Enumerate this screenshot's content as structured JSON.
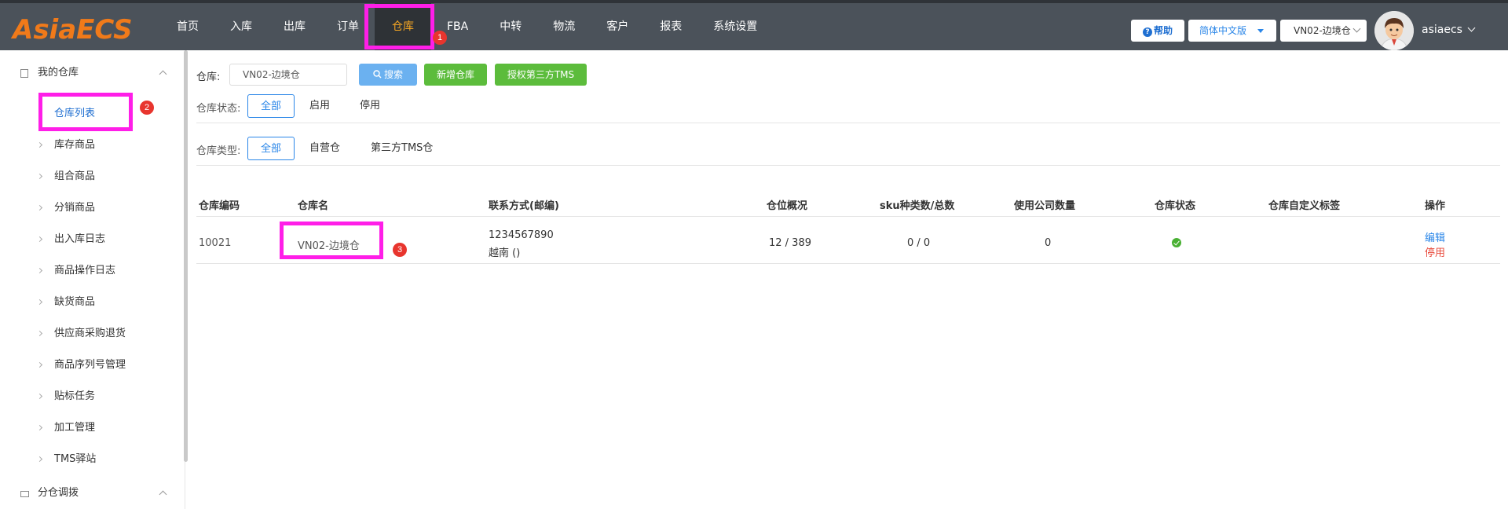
{
  "header": {
    "logo": "AsiaECS",
    "nav": [
      {
        "label": "首页"
      },
      {
        "label": "入库"
      },
      {
        "label": "出库"
      },
      {
        "label": "订单"
      },
      {
        "label": "仓库"
      },
      {
        "label": "FBA"
      },
      {
        "label": "中转"
      },
      {
        "label": "物流"
      },
      {
        "label": "客户"
      },
      {
        "label": "报表"
      },
      {
        "label": "系统设置"
      }
    ],
    "active_nav": "仓库",
    "help_label": "帮助",
    "help_icon": "question-circle-icon",
    "language": "简体中文版",
    "warehouse_select": "VN02-边境仓",
    "username": "asiaecs"
  },
  "sidebar": {
    "group1": {
      "label": "我的仓库"
    },
    "items": [
      {
        "label": "仓库列表"
      },
      {
        "label": "库存商品"
      },
      {
        "label": "组合商品"
      },
      {
        "label": "分销商品"
      },
      {
        "label": "出入库日志"
      },
      {
        "label": "商品操作日志"
      },
      {
        "label": "缺货商品"
      },
      {
        "label": "供应商采购退货"
      },
      {
        "label": "商品序列号管理"
      },
      {
        "label": "贴标任务"
      },
      {
        "label": "加工管理"
      },
      {
        "label": "TMS驿站"
      }
    ],
    "group2": {
      "label": "分仓调拨"
    }
  },
  "search": {
    "warehouse_label": "仓库:",
    "warehouse_value": "VN02-边境仓",
    "search_btn": "搜索",
    "add_btn": "新增仓库",
    "auth_btn": "授权第三方TMS"
  },
  "filters": {
    "status_label": "仓库状态:",
    "status_options": [
      "全部",
      "启用",
      "停用"
    ],
    "type_label": "仓库类型:",
    "type_options": [
      "全部",
      "自营仓",
      "第三方TMS仓"
    ]
  },
  "table": {
    "headers": [
      "仓库编码",
      "仓库名",
      "联系方式(邮编)",
      "仓位概况",
      "sku种类数/总数",
      "使用公司数量",
      "仓库状态",
      "仓库自定义标签",
      "操作"
    ],
    "rows": [
      {
        "code": "10021",
        "name": "VN02-边境仓",
        "phone": "1234567890",
        "region": "越南 ()",
        "locations": "12 / 389",
        "sku": "0 / 0",
        "companies": "0",
        "status": "enabled",
        "tag": "",
        "action_edit": "编辑",
        "action_disable": "停用"
      }
    ]
  },
  "annotations": {
    "badge1": "1",
    "badge2": "2",
    "badge3": "3"
  },
  "colors": {
    "highlight": "#ff1ee8",
    "badge": "#e8352e",
    "topbar": "#4b525a",
    "accent": "#2a86e8",
    "green": "#5cbc3c"
  }
}
